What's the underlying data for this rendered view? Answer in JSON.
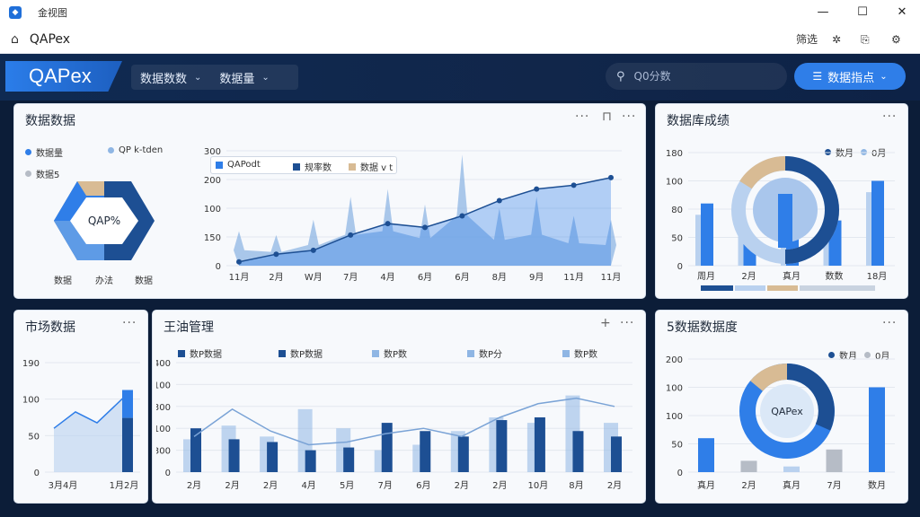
{
  "window": {
    "title": "金视图",
    "minimize": "—",
    "maximize": "☐",
    "close": "✕"
  },
  "addressbar": {
    "title": "QAPex",
    "tool1": "筛选",
    "tool2": "✲",
    "tool3": "⎘",
    "tool4": "⚙"
  },
  "appbar": {
    "logo": "QAPex",
    "nav": [
      {
        "label": "数据数数"
      },
      {
        "label": "数据量"
      }
    ],
    "search_placeholder": "Q0分数",
    "primary_button": "数据指点"
  },
  "cards": {
    "top_left": {
      "title": "数据数据",
      "pie_legend": [
        "数据量",
        "QP k-tden",
        "数据5"
      ],
      "hex_label": "QAP%",
      "pie_bottom_labels": [
        "数据",
        "办法",
        "数据"
      ],
      "line_legend": [
        "QAPodt",
        "规率数",
        "数据 v t"
      ],
      "y_ticks": [
        "300",
        "200",
        "100",
        "150",
        "0"
      ],
      "x_labels": [
        "11月",
        "2月",
        "W月",
        "7月",
        "4月",
        "6月",
        "6月",
        "8月",
        "9月",
        "11月",
        "11月"
      ]
    },
    "top_right": {
      "title": "数据库成绩",
      "legend": [
        "数月",
        "0月"
      ],
      "y_ticks": [
        "180",
        "100",
        "80",
        "50",
        "0"
      ],
      "x_labels": [
        "周月",
        "2月",
        "真月",
        "数数",
        "18月"
      ]
    },
    "bottom_left": {
      "title": "市场数据",
      "y_ticks": [
        "190",
        "100",
        "50",
        "0"
      ],
      "x_labels": [
        "3月4月",
        "1月2月"
      ]
    },
    "bottom_middle": {
      "title": "王油管理",
      "legend": [
        "数P数据",
        "数P数据",
        "数P数",
        "数P分",
        "数P数"
      ],
      "y_ticks": [
        "400",
        "100",
        "300",
        "100",
        "300",
        "0"
      ],
      "x_labels": [
        "2月",
        "2月",
        "2月",
        "4月",
        "5月",
        "7月",
        "6月",
        "2月",
        "2月",
        "10月",
        "8月",
        "2月"
      ]
    },
    "bottom_right": {
      "title": "5数据数据度",
      "legend": [
        "数月",
        "0月"
      ],
      "donut_label": "QAPex",
      "y_ticks": [
        "200",
        "100",
        "100",
        "50",
        "0"
      ],
      "x_labels": [
        "真月",
        "2月",
        "真月",
        "7月",
        "数月"
      ]
    }
  },
  "colors": {
    "dark_blue": "#1d4f93",
    "mid_blue": "#2f7ee8",
    "light_blue": "#8fb6e4",
    "pale_blue": "#b9d1ef",
    "tan": "#d8bb94",
    "grey": "#b6bcc6"
  },
  "chart_data": [
    {
      "type": "area",
      "series": [
        {
          "values": [
            10,
            30,
            40,
            80,
            110,
            100,
            130,
            170,
            200,
            210,
            230
          ]
        },
        {
          "values": [
            90,
            80,
            120,
            180,
            200,
            160,
            290,
            150,
            180,
            130,
            120
          ]
        }
      ],
      "ylim": [
        0,
        300
      ]
    },
    {
      "type": "bar",
      "series": [
        {
          "name": "数月",
          "values": [
            110,
            50,
            140,
            80,
            150
          ]
        },
        {
          "name": "0月",
          "values": [
            90,
            70,
            110,
            60,
            130
          ]
        }
      ],
      "ylim": [
        0,
        200
      ]
    },
    {
      "type": "bar",
      "values": [
        150
      ],
      "line": [
        80,
        110,
        90,
        140
      ],
      "ylim": [
        0,
        200
      ]
    },
    {
      "type": "bar",
      "series": [
        {
          "values": [
            160,
            120,
            110,
            80,
            90,
            180,
            150,
            130,
            190,
            200,
            150,
            130
          ]
        },
        {
          "values": [
            120,
            170,
            130,
            230,
            160,
            80,
            100,
            150,
            200,
            180,
            280,
            180
          ]
        }
      ],
      "line": [
        130,
        230,
        150,
        100,
        110,
        140,
        160,
        130,
        200,
        250,
        270,
        240
      ],
      "ylim": [
        0,
        400
      ]
    },
    {
      "type": "bar",
      "series": [
        {
          "name": "数月",
          "values": [
            60,
            20,
            10,
            40,
            150
          ]
        }
      ],
      "ylim": [
        0,
        200
      ]
    }
  ]
}
